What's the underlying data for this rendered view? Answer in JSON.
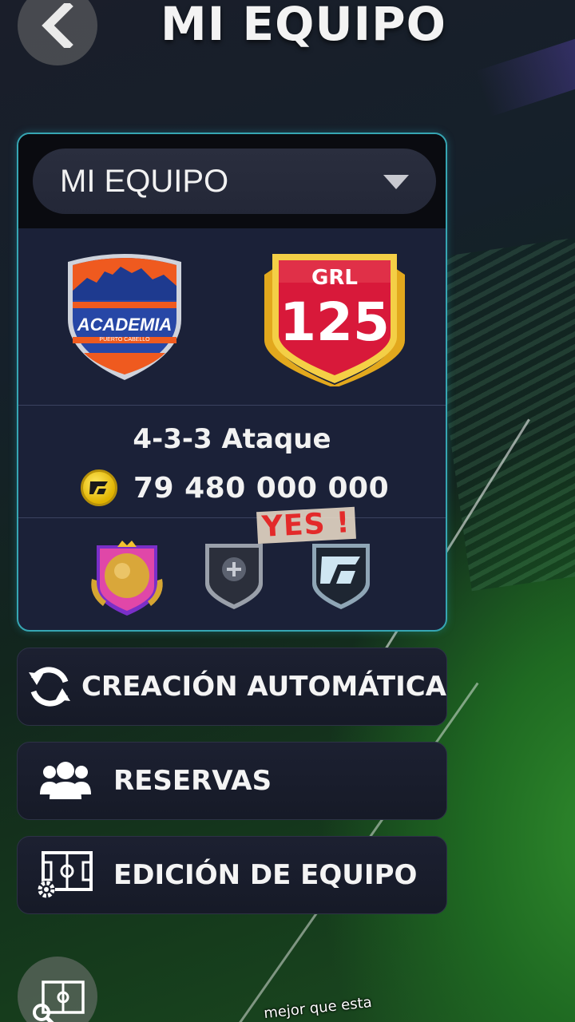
{
  "header": {
    "title": "MI EQUIPO"
  },
  "team_card": {
    "selected_team": "MI EQUIPO",
    "club_name": "ACADEMIA",
    "club_subtitle": "PUERTO CABELLO",
    "rating_label": "GRL",
    "rating_value": "125",
    "formation": "4-3-3 Ataque",
    "coins": "79 480 000 000"
  },
  "overlay": {
    "sticker_text": "YES !",
    "caption_text": "mejor que esta"
  },
  "menu": {
    "auto_create": "CREACIÓN AUTOMÁTICA",
    "reserves": "RESERVAS",
    "team_edit": "EDICIÓN DE EQUIPO"
  },
  "colors": {
    "card_border": "#36a6b3",
    "card_bg": "#1b2138",
    "rating_red": "#d8193a",
    "rating_gold": "#f2c230",
    "crest_orange": "#ef5a1f",
    "crest_blue": "#2747a6",
    "coin_yellow": "#f5d51a"
  },
  "icons": {
    "back": "chevron-left-icon",
    "dropdown": "triangle-down-icon",
    "coin": "fc-coin-icon",
    "auto": "refresh-icon",
    "reserves": "group-icon",
    "edit": "pitch-gear-icon",
    "fab": "pitch-search-icon"
  }
}
